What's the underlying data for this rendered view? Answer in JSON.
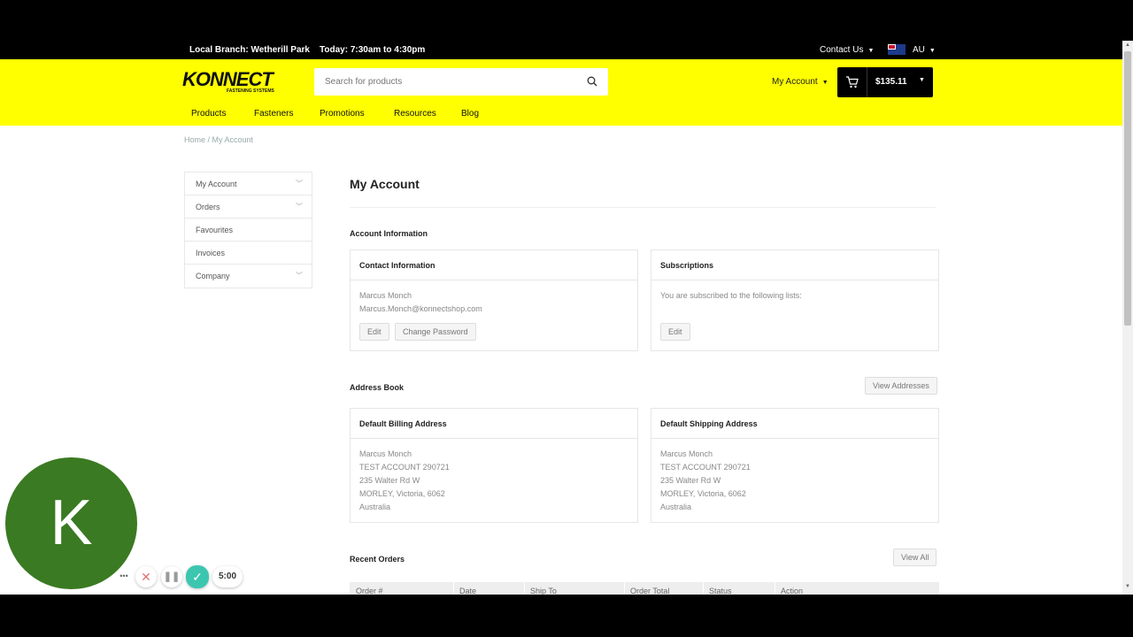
{
  "topbar": {
    "branch": "Local Branch: Wetherill Park",
    "hours": "Today: 7:30am to 4:30pm",
    "contact": "Contact Us",
    "region": "AU"
  },
  "header": {
    "logo_text": "KONNECT",
    "logo_sub": "FASTENING SYSTEMS",
    "search_placeholder": "Search for products",
    "my_account": "My Account",
    "cart_total": "$135.11"
  },
  "nav": [
    "Products",
    "Fasteners",
    "Promotions",
    "Resources",
    "Blog"
  ],
  "breadcrumb": "Home / My Account",
  "sidebar": {
    "items": [
      {
        "label": "My Account"
      },
      {
        "label": "Orders"
      },
      {
        "label": "Favourites"
      },
      {
        "label": "Invoices"
      },
      {
        "label": "Company"
      }
    ]
  },
  "page": {
    "title": "My Account",
    "account_info_heading": "Account Information",
    "contact": {
      "heading": "Contact Information",
      "name": "Marcus Monch",
      "email": "Marcus.Monch@konnectshop.com",
      "edit": "Edit",
      "change_password": "Change Password"
    },
    "subscriptions": {
      "heading": "Subscriptions",
      "text": "You are subscribed to the following lists:",
      "edit": "Edit"
    },
    "address_book_heading": "Address Book",
    "view_addresses": "View Addresses",
    "billing": {
      "heading": "Default Billing Address",
      "lines": [
        "Marcus Monch",
        "TEST ACCOUNT 290721",
        "235 Walter Rd W",
        "MORLEY, Victoria, 6062",
        "Australia"
      ]
    },
    "shipping": {
      "heading": "Default Shipping Address",
      "lines": [
        "Marcus Monch",
        "TEST ACCOUNT 290721",
        "235 Walter Rd W",
        "MORLEY, Victoria, 6062",
        "Australia"
      ]
    },
    "recent_orders_heading": "Recent Orders",
    "view_all": "View All",
    "table_columns": [
      "Order #",
      "Date",
      "Ship To",
      "Order Total",
      "Status",
      "Action"
    ]
  },
  "overlay": {
    "avatar_letter": "K",
    "timer": "5:00"
  },
  "colors": {
    "brand_yellow": "#ffff00",
    "avatar_green": "#3a7a22",
    "confirm_teal": "#3cc6b0"
  }
}
